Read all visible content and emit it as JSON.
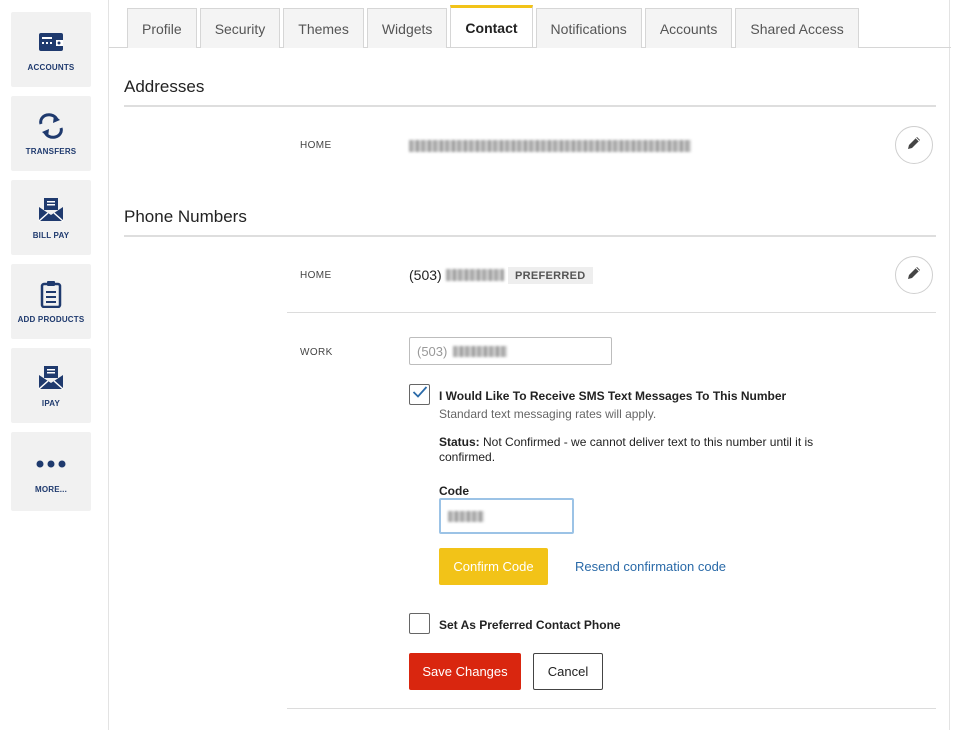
{
  "sidebar": {
    "items": [
      {
        "label": "ACCOUNTS",
        "icon": "wallet-icon"
      },
      {
        "label": "TRANSFERS",
        "icon": "transfer-arrows-icon"
      },
      {
        "label": "BILL PAY",
        "icon": "envelope-bill-icon"
      },
      {
        "label": "ADD PRODUCTS",
        "icon": "clipboard-icon"
      },
      {
        "label": "IPAY",
        "icon": "envelope-pay-icon"
      },
      {
        "label": "MORE...",
        "icon": "more-dots-icon"
      }
    ]
  },
  "tabs": [
    {
      "label": "Profile",
      "active": false
    },
    {
      "label": "Security",
      "active": false
    },
    {
      "label": "Themes",
      "active": false
    },
    {
      "label": "Widgets",
      "active": false
    },
    {
      "label": "Contact",
      "active": true
    },
    {
      "label": "Notifications",
      "active": false
    },
    {
      "label": "Accounts",
      "active": false
    },
    {
      "label": "Shared Access",
      "active": false
    }
  ],
  "addresses": {
    "title": "Addresses",
    "home_label": "HOME"
  },
  "phones": {
    "title": "Phone Numbers",
    "home_label": "HOME",
    "home_prefix": "(503)",
    "preferred_badge": "PREFERRED",
    "work_label": "WORK",
    "work_value": "(503)",
    "sms_label": "I Would Like To Receive SMS Text Messages To This Number",
    "sms_checked": true,
    "rates_note": "Standard text messaging rates will apply.",
    "status_label": "Status:",
    "status_text": "Not Confirmed - we cannot deliver text to this number until it is confirmed.",
    "code_label": "Code",
    "confirm_button": "Confirm Code",
    "resend_link": "Resend confirmation code",
    "preferred_label": "Set As Preferred Contact Phone",
    "preferred_checked": false,
    "save_button": "Save Changes",
    "cancel_button": "Cancel"
  },
  "colors": {
    "accent_yellow": "#f2c318",
    "save_red": "#d9260f",
    "link_blue": "#2a6aa8",
    "sidebar_navy": "#1f3a6e"
  }
}
